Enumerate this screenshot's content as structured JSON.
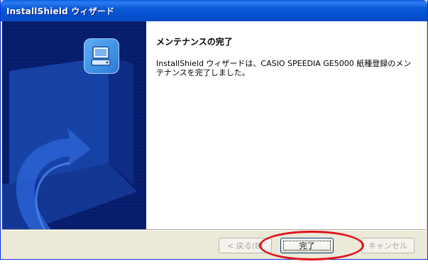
{
  "window": {
    "title": "InstallShield ウィザード"
  },
  "content": {
    "heading": "メンテナンスの完了",
    "message": "InstallShield ウィザードは、CASIO SPEEDIA GE5000 紙種登録のメンテナンスを完了しました。"
  },
  "buttons": {
    "back": "< 戻る(B)",
    "finish": "完了",
    "cancel": "キャンセル"
  },
  "colors": {
    "title_bar": "#0a5ad6",
    "banner": "#01135c",
    "highlight": "#e0141b"
  },
  "icons": {
    "banner": "computer-setup-icon"
  }
}
